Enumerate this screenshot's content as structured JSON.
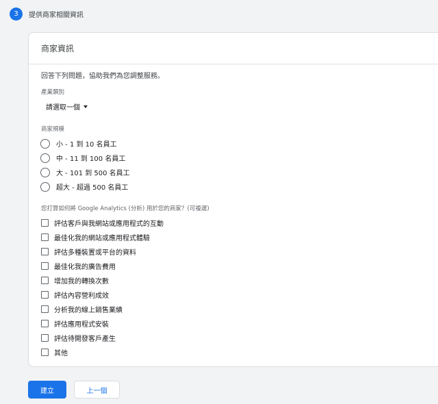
{
  "step": {
    "number": "3",
    "title": "提供商家相關資訊"
  },
  "card": {
    "title": "商家資訊",
    "intro": "回答下列問題，協助我們為您調整服務。"
  },
  "industry": {
    "label": "產業類別",
    "selected": "請選取一個"
  },
  "business_size": {
    "label": "商家規模",
    "options": [
      "小 - 1 到 10 名員工",
      "中 - 11 到 100 名員工",
      "大 - 101 到 500 名員工",
      "超大 - 超過 500 名員工"
    ]
  },
  "usage": {
    "label": "您打算如何將 Google Analytics (分析) 用於您的商家？(可複選)",
    "options": [
      "評估客戶與我網站或應用程式的互動",
      "最佳化我的網站或應用程式體驗",
      "評估多種裝置或平台的資料",
      "最佳化我的廣告費用",
      "增加我的轉換次數",
      "評估內容營利成效",
      "分析我的線上銷售業績",
      "評估應用程式安裝",
      "評估待開發客戶產生",
      "其他"
    ]
  },
  "buttons": {
    "create": "建立",
    "previous": "上一個"
  },
  "colors": {
    "accent": "#1a73e8",
    "background": "#f1f3f4"
  }
}
